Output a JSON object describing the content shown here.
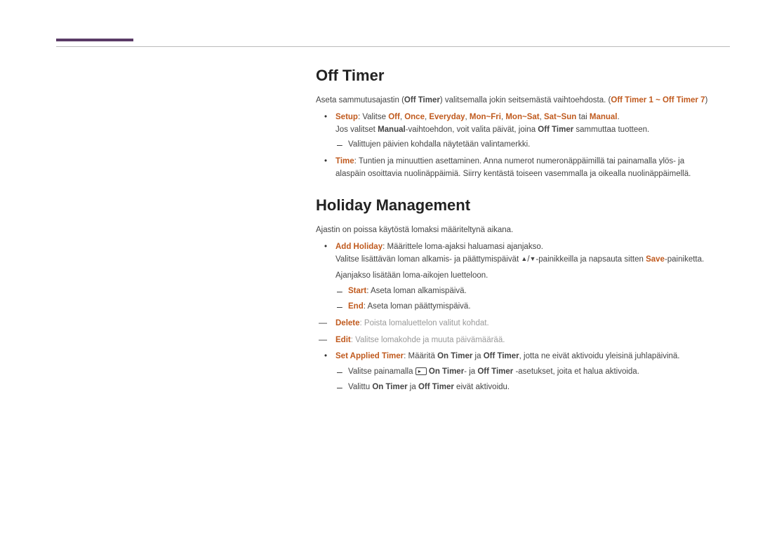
{
  "section1": {
    "heading": "Off Timer",
    "intro_pre": "Aseta sammutusajastin (",
    "intro_bold1": "Off Timer",
    "intro_mid": ") valitsemalla jokin seitsemästä vaihtoehdosta. (",
    "intro_hl": "Off Timer 1 ~ Off Timer 7",
    "intro_post": ")",
    "setup_label": "Setup",
    "setup_colon": ": Valitse ",
    "opt_off": "Off",
    "s_c1": ", ",
    "opt_once": "Once",
    "s_c2": ", ",
    "opt_every": "Everyday",
    "s_c3": ", ",
    "opt_mf": "Mon~Fri",
    "s_c4": ", ",
    "opt_ms": "Mon~Sat",
    "s_c5": ", ",
    "opt_ss": "Sat~Sun",
    "setup_tai": " tai ",
    "opt_manual": "Manual",
    "setup_end": ".",
    "setup_line2a": "Jos valitset ",
    "setup_line2b": "Manual",
    "setup_line2c": "-vaihtoehdon, voit valita päivät, joina ",
    "setup_line2d": "Off Timer",
    "setup_line2e": " sammuttaa tuotteen.",
    "setup_dash1": "Valittujen päivien kohdalla näytetään valintamerkki.",
    "time_label": "Time",
    "time_text": ": Tuntien ja minuuttien asettaminen. Anna numerot numeronäppäimillä tai painamalla ylös- ja alaspäin osoittavia nuolinäppäimiä. Siirry kentästä toiseen vasemmalla ja oikealla nuolinäppäimellä."
  },
  "section2": {
    "heading": "Holiday Management",
    "intro": "Ajastin on poissa käytöstä lomaksi määriteltynä aikana.",
    "add_label": "Add Holiday",
    "add_text": ": Määrittele loma-ajaksi haluamasi ajanjakso.",
    "add_line2a": "Valitse lisättävän loman alkamis- ja päättymispäivät ",
    "tri_up": "▲",
    "tri_sep": "/",
    "tri_dn": "▼",
    "add_line2b": "-painikkeilla ja napsauta sitten ",
    "save": "Save",
    "add_line2c": "-painiketta.",
    "add_line3": "Ajanjakso lisätään loma-aikojen luetteloon.",
    "start_label": "Start",
    "start_text": ": Aseta loman alkamispäivä.",
    "end_label": "End",
    "end_text": ": Aseta loman päättymispäivä.",
    "delete_label": "Delete",
    "delete_text": ": Poista lomaluettelon valitut kohdat.",
    "edit_label": "Edit",
    "edit_text": ": Valitse lomakohde ja muuta päivämäärää.",
    "sat_label": "Set Applied Timer",
    "sat_a": ": Määritä ",
    "sat_on": "On Timer",
    "sat_ja": " ja ",
    "sat_off": "Off Timer",
    "sat_b": ", jotta ne eivät aktivoidu yleisinä juhlapäivinä.",
    "sat_d1a": "Valitse painamalla ",
    "sat_d1b": "On Timer",
    "sat_d1c": "- ja ",
    "sat_d1d": "Off Timer",
    "sat_d1e": " -asetukset, joita et halua aktivoida.",
    "sat_d2a": "Valittu ",
    "sat_d2b": "On Timer",
    "sat_d2c": " ja ",
    "sat_d2d": "Off Timer",
    "sat_d2e": " eivät aktivoidu."
  }
}
